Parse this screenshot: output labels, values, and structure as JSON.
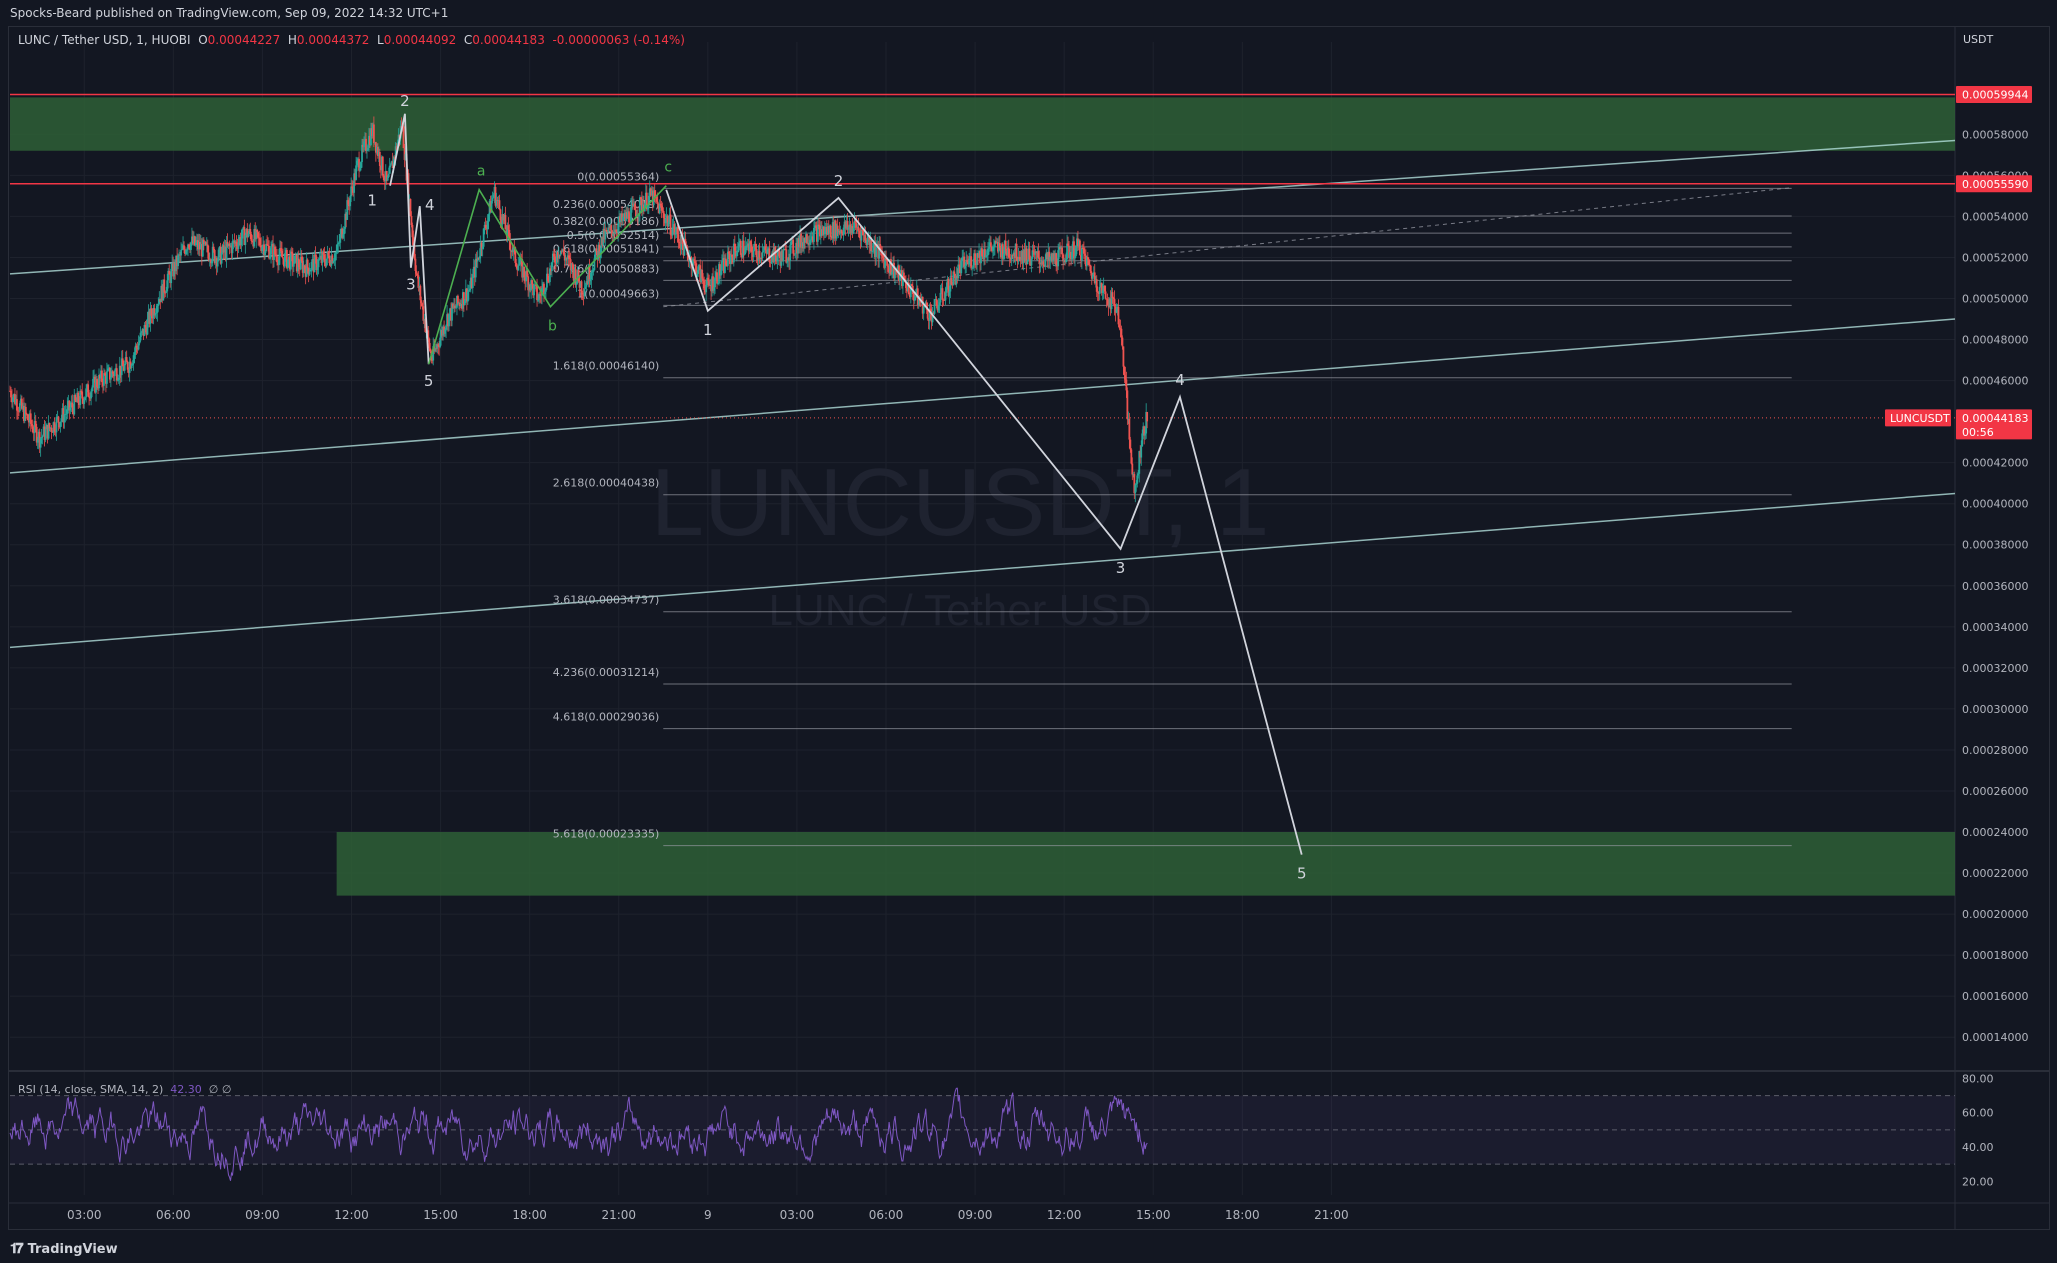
{
  "header": {
    "published": "Spocks-Beard published on TradingView.com, Sep 09, 2022 14:32 UTC+1"
  },
  "legend": {
    "symbol": "LUNC / Tether USD, 1, HUOBI",
    "open_label": "O",
    "open": "0.00044227",
    "high_label": "H",
    "high": "0.00044372",
    "low_label": "L",
    "low": "0.00044092",
    "close_label": "C",
    "close": "0.00044183",
    "change": "-0.00000063 (-0.14%)"
  },
  "rsi_legend": {
    "label": "RSI (14, close, SMA, 14, 2)",
    "value": "42.30",
    "extra": "∅  ∅"
  },
  "currency": "USDT",
  "footer": {
    "brand": "TradingView",
    "icon": "tradingview-logo-icon"
  },
  "colors": {
    "background": "#131722",
    "grid": "#1e222d",
    "up": "#26a69a",
    "down": "#ef5350",
    "zone": "#2e5f36",
    "resistance": "#f23645",
    "rsi": "#7e57c2",
    "wave": "#d1d4dc",
    "wave_green": "#4caf50",
    "channel": "#b2dfdb"
  },
  "chart_data": {
    "type": "candlestick",
    "symbol": "LUNCUSDT",
    "interval": "1",
    "exchange": "HUOBI",
    "watermark": {
      "ticker": "LUNCUSDT, 1",
      "name": "LUNC / Tether USD"
    },
    "y_axis": {
      "range": [
        0.000125,
        0.000625
      ],
      "ticks": [
        "0.00058000",
        "0.00056000",
        "0.00054000",
        "0.00052000",
        "0.00050000",
        "0.00048000",
        "0.00046000",
        "0.00042000",
        "0.00040000",
        "0.00038000",
        "0.00036000",
        "0.00034000",
        "0.00032000",
        "0.00030000",
        "0.00028000",
        "0.00026000",
        "0.00024000",
        "0.00022000",
        "0.00020000",
        "0.00018000",
        "0.00016000",
        "0.00014000"
      ]
    },
    "x_axis": {
      "ticks": [
        {
          "label": "03:00",
          "t": 3
        },
        {
          "label": "06:00",
          "t": 6
        },
        {
          "label": "09:00",
          "t": 9
        },
        {
          "label": "12:00",
          "t": 12
        },
        {
          "label": "15:00",
          "t": 15
        },
        {
          "label": "18:00",
          "t": 18
        },
        {
          "label": "21:00",
          "t": 21
        },
        {
          "label": "9",
          "t": 24
        },
        {
          "label": "03:00",
          "t": 27
        },
        {
          "label": "06:00",
          "t": 30
        },
        {
          "label": "09:00",
          "t": 33
        },
        {
          "label": "12:00",
          "t": 36
        },
        {
          "label": "15:00",
          "t": 39
        },
        {
          "label": "18:00",
          "t": 42
        },
        {
          "label": "21:00",
          "t": 45
        }
      ],
      "range": [
        0.5,
        66
      ]
    },
    "price_path": [
      [
        0.5,
        0.000455
      ],
      [
        1.5,
        0.000432
      ],
      [
        2.5,
        0.000446
      ],
      [
        3.5,
        0.00046
      ],
      [
        4.5,
        0.000468
      ],
      [
        5.5,
        0.0005
      ],
      [
        6.5,
        0.000528
      ],
      [
        7.5,
        0.00052
      ],
      [
        8.5,
        0.000532
      ],
      [
        9.5,
        0.000521
      ],
      [
        10.5,
        0.000515
      ],
      [
        11.5,
        0.000522
      ],
      [
        12.2,
        0.000565
      ],
      [
        12.7,
        0.000582
      ],
      [
        13.2,
        0.000555
      ],
      [
        13.7,
        0.000585
      ],
      [
        14.2,
        0.00051
      ],
      [
        14.7,
        0.00047
      ],
      [
        15.2,
        0.00049
      ],
      [
        16.0,
        0.000505
      ],
      [
        16.8,
        0.000552
      ],
      [
        17.5,
        0.00052
      ],
      [
        18.3,
        0.0005
      ],
      [
        19.0,
        0.000525
      ],
      [
        19.8,
        0.000505
      ],
      [
        20.5,
        0.00053
      ],
      [
        21.3,
        0.00054
      ],
      [
        22.1,
        0.00055
      ],
      [
        23.0,
        0.00053
      ],
      [
        24.0,
        0.000505
      ],
      [
        25.0,
        0.000525
      ],
      [
        26.5,
        0.00052
      ],
      [
        27.5,
        0.000532
      ],
      [
        29.0,
        0.000535
      ],
      [
        30.5,
        0.00051
      ],
      [
        31.5,
        0.000492
      ],
      [
        32.5,
        0.000515
      ],
      [
        33.5,
        0.000525
      ],
      [
        34.5,
        0.000522
      ],
      [
        35.5,
        0.000518
      ],
      [
        36.5,
        0.000525
      ],
      [
        37.2,
        0.000505
      ],
      [
        37.8,
        0.000495
      ],
      [
        38.0,
        0.00047
      ],
      [
        38.2,
        0.00043
      ],
      [
        38.4,
        0.000405
      ],
      [
        38.6,
        0.000432
      ],
      [
        38.8,
        0.000442
      ]
    ],
    "last_price": "0.00044183",
    "countdown": "00:56",
    "price_labels": [
      {
        "text": "0.00059944",
        "price": 0.00059944
      },
      {
        "text": "0.00055590",
        "price": 0.0005559
      },
      {
        "text": "0.00044183",
        "price": 0.00044183,
        "tag": "LUNCUSDT"
      }
    ],
    "horizontal_lines": [
      {
        "price": 0.00059944,
        "color": "#f23645"
      },
      {
        "price": 0.0005559,
        "color": "#f23645"
      }
    ],
    "zones": [
      {
        "top": 0.000598,
        "bottom": 0.000572,
        "t_start": 0.5,
        "t_end": 66
      },
      {
        "top": 0.00024,
        "bottom": 0.000209,
        "t_start": 11.5,
        "t_end": 66
      }
    ],
    "fibonacci": [
      {
        "label": "0(0.00055364)",
        "price": 0.00055364
      },
      {
        "label": "0.236(0.00054019)",
        "price": 0.00054019
      },
      {
        "label": "0.382(0.00053186)",
        "price": 0.00053186
      },
      {
        "label": "0.5(0.00052514)",
        "price": 0.00052514
      },
      {
        "label": "0.618(0.00051841)",
        "price": 0.00051841
      },
      {
        "label": "0.786(0.00050883)",
        "price": 0.00050883
      },
      {
        "label": "1(0.00049663)",
        "price": 0.00049663
      },
      {
        "label": "1.618(0.00046140)",
        "price": 0.0004614
      },
      {
        "label": "2.618(0.00040438)",
        "price": 0.00040438
      },
      {
        "label": "3.618(0.00034737)",
        "price": 0.00034737
      },
      {
        "label": "4.236(0.00031214)",
        "price": 0.00031214
      },
      {
        "label": "4.618(0.00029036)",
        "price": 0.00029036
      },
      {
        "label": "5.618(0.00023335)",
        "price": 0.00023335
      }
    ],
    "fib_range": {
      "t_start": 22.5,
      "t_end": 60.5
    },
    "channels": [
      {
        "t1": 0.5,
        "p1": 0.000512,
        "t2": 66,
        "p2": 0.000577
      },
      {
        "t1": 0.5,
        "p1": 0.000415,
        "t2": 66,
        "p2": 0.00049
      },
      {
        "t1": 0.5,
        "p1": 0.00033,
        "t2": 66,
        "p2": 0.000405
      }
    ],
    "waves_main": [
      {
        "t": 13.3,
        "p": 0.000555,
        "label": "1"
      },
      {
        "t": 13.8,
        "p": 0.00059,
        "label": "2"
      },
      {
        "t": 14.0,
        "p": 0.000515,
        "label": "3"
      },
      {
        "t": 14.3,
        "p": 0.000545,
        "label": "4"
      },
      {
        "t": 14.6,
        "p": 0.000468,
        "label": "5"
      }
    ],
    "waves_abc": [
      {
        "t": 14.6,
        "p": 0.000468,
        "label": ""
      },
      {
        "t": 16.3,
        "p": 0.000553,
        "label": "a"
      },
      {
        "t": 18.7,
        "p": 0.000496,
        "label": "b"
      },
      {
        "t": 22.6,
        "p": 0.000555,
        "label": "c"
      }
    ],
    "waves_projection": [
      {
        "t": 22.6,
        "p": 0.000553,
        "label": ""
      },
      {
        "t": 24.0,
        "p": 0.000494,
        "label": "1"
      },
      {
        "t": 28.4,
        "p": 0.000549,
        "label": "2"
      },
      {
        "t": 37.9,
        "p": 0.000378,
        "label": "3"
      },
      {
        "t": 39.9,
        "p": 0.000452,
        "label": "4"
      },
      {
        "t": 44.0,
        "p": 0.000229,
        "label": "5"
      }
    ],
    "rsi": {
      "label": "RSI (14, close, SMA, 14, 2)",
      "last": 42.3,
      "range": [
        12,
        82
      ],
      "upper": 70,
      "lower": 30,
      "mid": 50,
      "ticks": [
        "80.00",
        "60.00",
        "40.00",
        "20.00"
      ]
    }
  }
}
